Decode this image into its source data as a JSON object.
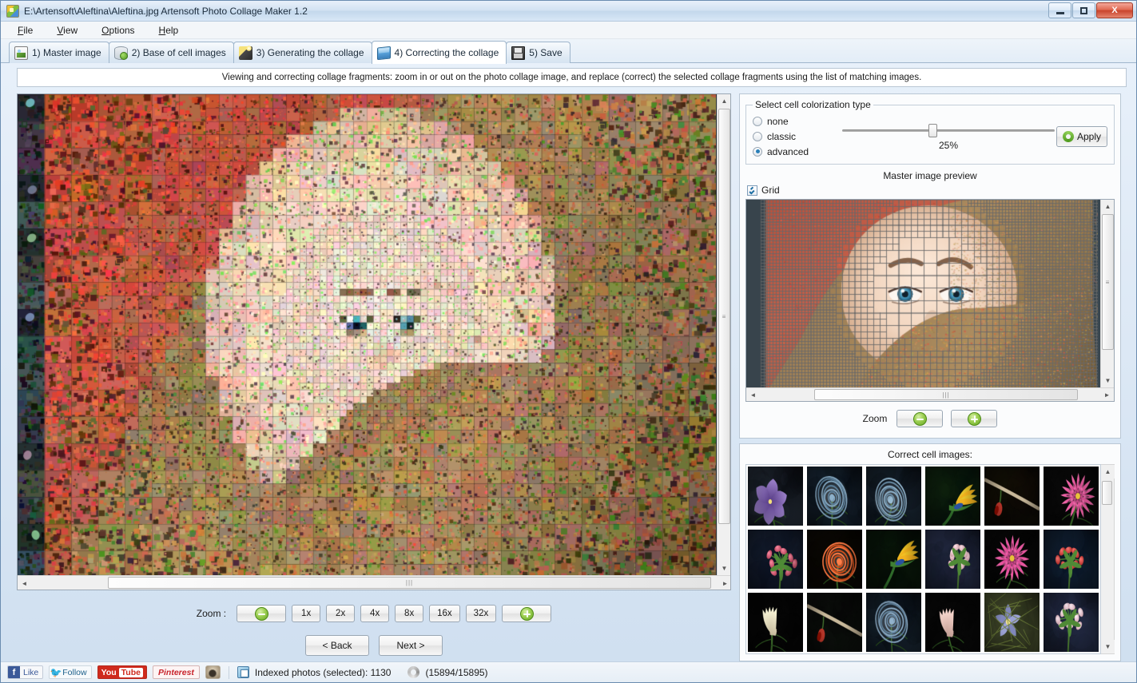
{
  "window": {
    "title": "E:\\Artensoft\\Aleftina\\Aleftina.jpg  Artensoft Photo Collage Maker 1.2",
    "app_icon": "collage-app-icon",
    "minimize_label": "",
    "maximize_label": "",
    "close_label": "X"
  },
  "menu": {
    "items": [
      {
        "label": "File",
        "accel": "F"
      },
      {
        "label": "View",
        "accel": "V"
      },
      {
        "label": "Options",
        "accel": "O"
      },
      {
        "label": "Help",
        "accel": "H"
      }
    ]
  },
  "tabs": [
    {
      "label": "1) Master image",
      "icon": "picture-icon",
      "active": false
    },
    {
      "label": "2) Base of cell images",
      "icon": "database-add-icon",
      "active": false
    },
    {
      "label": "3) Generating the collage",
      "icon": "magic-wand-icon",
      "active": false
    },
    {
      "label": "4) Correcting the collage",
      "icon": "blue-cube-icon",
      "active": true
    },
    {
      "label": "5) Save",
      "icon": "floppy-disk-icon",
      "active": false
    }
  ],
  "hint": {
    "text": "Viewing and correcting collage fragments: zoom in or out on the photo collage image, and replace (correct) the selected collage fragments using the list of matching images."
  },
  "colorization": {
    "group_title": "Select cell colorization type",
    "options": [
      {
        "label": "none",
        "selected": false
      },
      {
        "label": "classic",
        "selected": false
      },
      {
        "label": "advanced",
        "selected": true
      }
    ],
    "slider_percent": "25%",
    "slider_value": 25,
    "apply_label": "Apply",
    "apply_icon": "recycle-icon"
  },
  "preview": {
    "title": "Master image preview",
    "grid_checkbox_label": "Grid",
    "grid_checked": true,
    "zoom_label": "Zoom",
    "zoom_out_icon": "zoom-out-icon",
    "zoom_in_icon": "zoom-in-icon"
  },
  "cells": {
    "title": "Correct cell images:",
    "thumbnails": [
      {
        "name": "purple-iris",
        "c1": "#2a3440",
        "c2": "#7a5fa8",
        "c3": "#0d1016",
        "style": "iris"
      },
      {
        "name": "blue-rose-1",
        "c1": "#1b2a38",
        "c2": "#6f93ad",
        "c3": "#0a1119",
        "style": "rose"
      },
      {
        "name": "blue-rose-2",
        "c1": "#1d2c3a",
        "c2": "#7a9cb4",
        "c3": "#0b1219",
        "style": "rose"
      },
      {
        "name": "bird-of-paradise-1",
        "c1": "#10240f",
        "c2": "#e8c32a",
        "c3": "#06120a",
        "style": "bird"
      },
      {
        "name": "red-rosebud-branch",
        "c1": "#141007",
        "c2": "#b8352a",
        "c3": "#0a0804",
        "style": "bud"
      },
      {
        "name": "pink-dahlia-1",
        "c1": "#0c0c0c",
        "c2": "#e2569a",
        "c3": "#060606",
        "style": "dahlia"
      },
      {
        "name": "pink-buds-cluster-1",
        "c1": "#1a2436",
        "c2": "#cf5d74",
        "c3": "#0c1220",
        "style": "cluster"
      },
      {
        "name": "orange-rose",
        "c1": "#0d0a06",
        "c2": "#e8622c",
        "c3": "#070502",
        "style": "rose"
      },
      {
        "name": "bird-of-paradise-2",
        "c1": "#0a1a0c",
        "c2": "#f0c224",
        "c3": "#050d06",
        "style": "bird"
      },
      {
        "name": "pink-buds-blue-bg",
        "c1": "#2b3350",
        "c2": "#e6b8bf",
        "c3": "#161b2c",
        "style": "cluster"
      },
      {
        "name": "pink-dahlia-2",
        "c1": "#090909",
        "c2": "#e4509b",
        "c3": "#050505",
        "style": "dahlia"
      },
      {
        "name": "red-buds-green",
        "c1": "#15263a",
        "c2": "#cf4a45",
        "c3": "#0a1422",
        "style": "cluster"
      },
      {
        "name": "white-tulip",
        "c1": "#070707",
        "c2": "#f2e6c8",
        "c3": "#040404",
        "style": "tulip"
      },
      {
        "name": "rosebud-branch",
        "c1": "#101410",
        "c2": "#c0392b",
        "c3": "#070907",
        "style": "bud"
      },
      {
        "name": "blue-rose-3",
        "c1": "#1c2b39",
        "c2": "#7494ae",
        "c3": "#0a1118",
        "style": "rose"
      },
      {
        "name": "pink-tulip",
        "c1": "#0a0a0a",
        "c2": "#eec9c0",
        "c3": "#050505",
        "style": "tulip"
      },
      {
        "name": "blue-columbine",
        "c1": "#4a5230",
        "c2": "#8e95c8",
        "c3": "#2b301c",
        "style": "columbine"
      },
      {
        "name": "pink-buds-bouquet",
        "c1": "#2a3450",
        "c2": "#eec3cc",
        "c3": "#151a2b",
        "style": "cluster"
      }
    ]
  },
  "collage_zoom": {
    "label": "Zoom  :",
    "zoom_out_icon": "zoom-out-icon",
    "zoom_in_icon": "zoom-in-icon",
    "levels": [
      "1x",
      "2x",
      "4x",
      "8x",
      "16x",
      "32x"
    ],
    "selected_level": "1x"
  },
  "navigation": {
    "back_label": "< Back",
    "next_label": "Next >"
  },
  "statusbar": {
    "social": [
      {
        "name": "facebook-like-button",
        "label": "Like"
      },
      {
        "name": "twitter-follow-button",
        "label": "Follow"
      },
      {
        "name": "youtube-button",
        "label": "You",
        "label2": "Tube"
      },
      {
        "name": "pinterest-button",
        "label": "Pinterest"
      },
      {
        "name": "instagram-button",
        "label": ""
      }
    ],
    "indexed_text": "Indexed photos (selected): 1130",
    "progress_text": "(15894/15895)"
  },
  "colors": {
    "accent_green": "#63a51f",
    "accent_blue": "#2a7fb8",
    "title_bar": "#d2e2f2",
    "close_red": "#c9432c"
  }
}
